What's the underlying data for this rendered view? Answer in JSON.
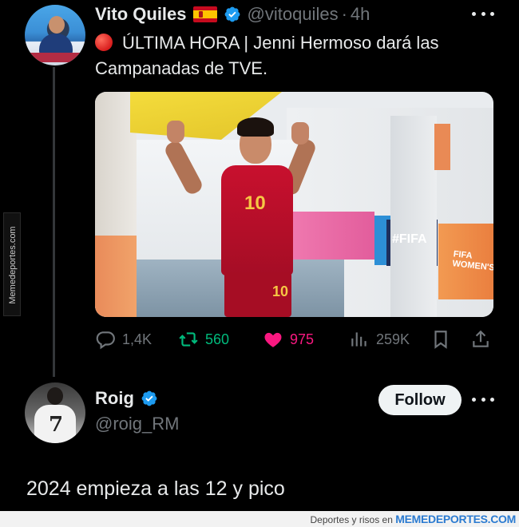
{
  "tweet": {
    "author_name": "Vito Quiles",
    "flag": "🇪🇸",
    "handle": "@vitoquiles",
    "separator": "·",
    "time": "4h",
    "text": "ÚLTIMA HORA | Jenni Hermoso dará las Campanadas de TVE.",
    "media": {
      "jersey_number": "10",
      "wall_text": "#FIFA",
      "wall_text2": "FIFA WOMEN'S"
    },
    "stats": {
      "replies": "1,4K",
      "retweets": "560",
      "likes": "975",
      "views": "259K"
    }
  },
  "reply": {
    "author_name": "Roig",
    "handle": "@roig_RM",
    "follow_label": "Follow",
    "text": "2024 empieza a las 12 y pico",
    "avatar_number": "7"
  },
  "watermark": {
    "side": "Memedeportes.com",
    "footer_prefix": "Deportes y risos en",
    "footer_brand": "MEMEDEPORTES.COM"
  },
  "colors": {
    "background": "#000000",
    "text": "#e7e9ea",
    "secondary": "#71767b",
    "verified": "#1d9bf0",
    "retweet": "#00ba7c",
    "like": "#f91880"
  },
  "icons": [
    "reply-icon",
    "retweet-icon",
    "heart-icon",
    "views-icon",
    "bookmark-icon",
    "share-icon",
    "verified-icon",
    "more-icon",
    "red-circle-icon",
    "spain-flag-icon"
  ]
}
